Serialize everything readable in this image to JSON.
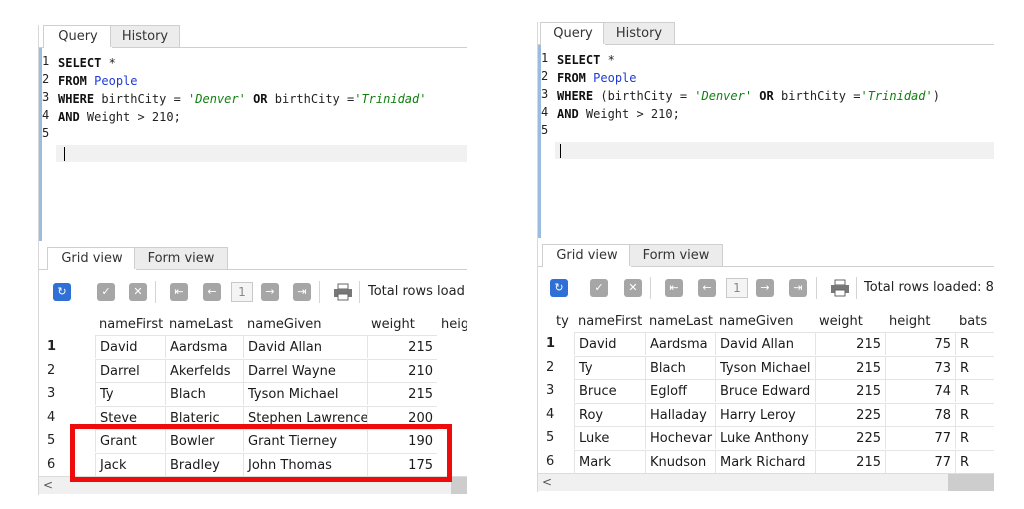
{
  "left": {
    "tabs": [
      "Query",
      "History"
    ],
    "line_numbers": [
      "1",
      "2",
      "3",
      "4",
      "5"
    ],
    "code": {
      "l1": {
        "kw": "SELECT",
        "rest": " *"
      },
      "l2": {
        "kw": "FROM",
        "table": "People"
      },
      "l3": {
        "kw1": "WHERE",
        "a": " birthCity = ",
        "s1": "'Denver'",
        "kw2": " OR",
        "b": " birthCity =",
        "s2": "'Trinidad'"
      },
      "l4": {
        "kw": "AND",
        "rest": " Weight > 210;"
      }
    },
    "view_tabs": [
      "Grid view",
      "Form view"
    ],
    "page_number": "1",
    "rows_loaded_label": "Total rows load",
    "columns": [
      "nameFirst",
      "nameLast",
      "nameGiven",
      "weight",
      "heig"
    ],
    "rows": [
      {
        "n": "1",
        "first": "David",
        "last": "Aardsma",
        "given": "David Allan",
        "weight": "215"
      },
      {
        "n": "2",
        "first": "Darrel",
        "last": "Akerfelds",
        "given": "Darrel Wayne",
        "weight": "210"
      },
      {
        "n": "3",
        "first": "Ty",
        "last": "Blach",
        "given": "Tyson Michael",
        "weight": "215"
      },
      {
        "n": "4",
        "first": "Steve",
        "last": "Blateric",
        "given": "Stephen Lawrence",
        "weight": "200"
      },
      {
        "n": "5",
        "first": "Grant",
        "last": "Bowler",
        "given": "Grant Tierney",
        "weight": "190"
      },
      {
        "n": "6",
        "first": "Jack",
        "last": "Bradley",
        "given": "John Thomas",
        "weight": "175"
      }
    ],
    "scroll_arrow": "<",
    "highlight_color": "#ee0b0b"
  },
  "right": {
    "tabs": [
      "Query",
      "History"
    ],
    "line_numbers": [
      "1",
      "2",
      "3",
      "4",
      "5"
    ],
    "code": {
      "l1": {
        "kw": "SELECT",
        "rest": " *"
      },
      "l2": {
        "kw": "FROM",
        "table": "People"
      },
      "l3": {
        "kw1": "WHERE",
        "a": " (birthCity = ",
        "s1": "'Denver'",
        "kw2": " OR",
        "b": " birthCity =",
        "s2": "'Trinidad'",
        "c": ")"
      },
      "l4": {
        "kw": "AND",
        "rest": " Weight > 210;"
      }
    },
    "view_tabs": [
      "Grid view",
      "Form view"
    ],
    "page_number": "1",
    "rows_loaded_label": "Total rows loaded: 8",
    "columns": [
      "ty",
      "nameFirst",
      "nameLast",
      "nameGiven",
      "weight",
      "height",
      "bats"
    ],
    "rows": [
      {
        "n": "1",
        "first": "David",
        "last": "Aardsma",
        "given": "David Allan",
        "weight": "215",
        "height": "75",
        "bats": "R"
      },
      {
        "n": "2",
        "first": "Ty",
        "last": "Blach",
        "given": "Tyson Michael",
        "weight": "215",
        "height": "73",
        "bats": "R"
      },
      {
        "n": "3",
        "first": "Bruce",
        "last": "Egloff",
        "given": "Bruce Edward",
        "weight": "215",
        "height": "74",
        "bats": "R"
      },
      {
        "n": "4",
        "first": "Roy",
        "last": "Halladay",
        "given": "Harry Leroy",
        "weight": "225",
        "height": "78",
        "bats": "R"
      },
      {
        "n": "5",
        "first": "Luke",
        "last": "Hochevar",
        "given": "Luke Anthony",
        "weight": "225",
        "height": "77",
        "bats": "R"
      },
      {
        "n": "6",
        "first": "Mark",
        "last": "Knudson",
        "given": "Mark Richard",
        "weight": "215",
        "height": "77",
        "bats": "R"
      }
    ],
    "scroll_arrow": "<"
  },
  "icons": {
    "refresh": "refresh-icon",
    "check": "check-icon",
    "cancel": "cancel-icon",
    "first": "first-page-icon",
    "prev": "prev-page-icon",
    "next": "next-page-icon",
    "last": "last-page-icon",
    "print": "print-icon"
  }
}
